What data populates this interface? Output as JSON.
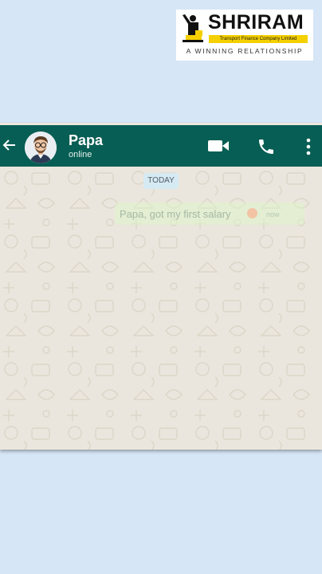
{
  "logo": {
    "name": "SHRIRAM",
    "subtitle": "Transport Finance Company Limited",
    "tagline": "A WINNING RELATIONSHIP"
  },
  "chat": {
    "contact_name": "Papa",
    "contact_status": "online",
    "date_label": "TODAY",
    "messages": [
      {
        "text": "Papa, got my first salary",
        "time": "now",
        "emoji": "slightly-smiling-face"
      }
    ]
  },
  "icons": {
    "back": "arrow-left-icon",
    "video": "video-camera-icon",
    "call": "phone-icon",
    "more": "more-vertical-icon"
  },
  "colors": {
    "header": "#075e54",
    "chat_background": "#ebe6dd",
    "outgoing_bubble": "#dcf8c6",
    "brand_yellow": "#f5d000",
    "page_background": "#d6e6f6"
  }
}
